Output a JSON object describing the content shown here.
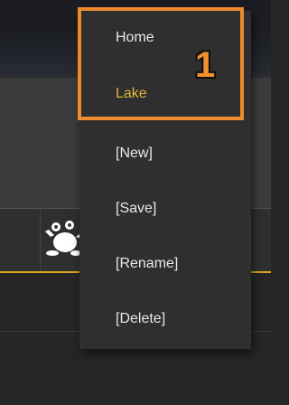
{
  "menu": {
    "items": [
      {
        "label": "Home"
      },
      {
        "label": "Lake"
      },
      {
        "label": "[New]"
      },
      {
        "label": "[Save]"
      },
      {
        "label": "[Rename]"
      },
      {
        "label": "[Delete]"
      }
    ],
    "selected_label": "Lake"
  },
  "callout": {
    "label": "1"
  },
  "icons": {
    "list_row": "frog-icon"
  },
  "colors": {
    "accent": "#d9a520",
    "highlight_border": "#ef8a2e",
    "selected_text": "#e3b53a"
  }
}
